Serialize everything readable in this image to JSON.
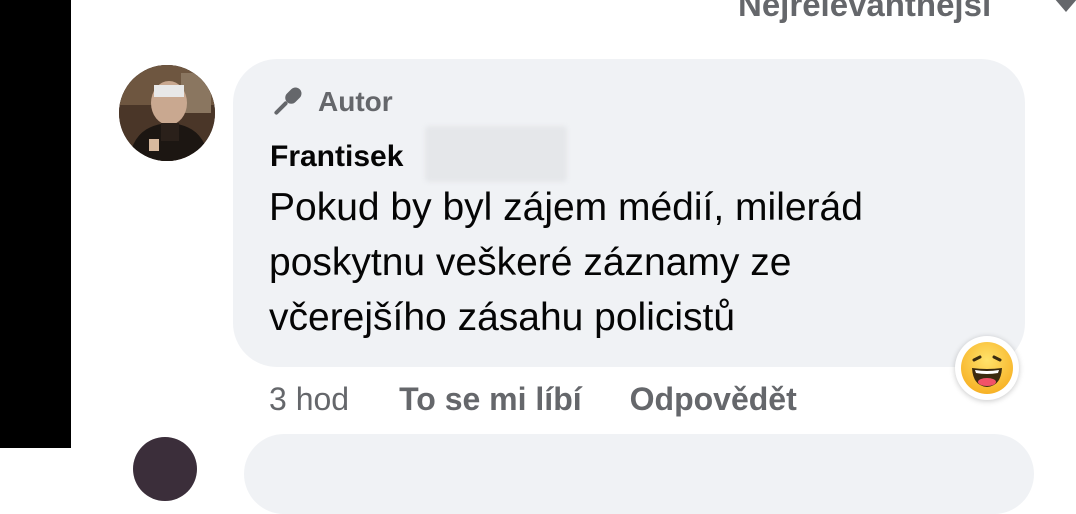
{
  "sort": {
    "label": "Nejrelevantnější",
    "icon": "chevron-down-icon"
  },
  "comment": {
    "author_badge": "Autor",
    "badge_icon": "microphone-icon",
    "name": "Frantisek",
    "text": "Pokud by byl zájem médií, milerád poskytnu veškeré záznamy ze včerejšího zásahu policistů",
    "time": "3 hod",
    "like_label": "To se mi líbí",
    "reply_label": "Odpovědět",
    "reaction_icon": "haha-emoji-icon"
  },
  "colors": {
    "bubble": "#f0f2f5",
    "secondary_text": "#65676b",
    "primary_text": "#050505",
    "left_bar": "#000000"
  }
}
